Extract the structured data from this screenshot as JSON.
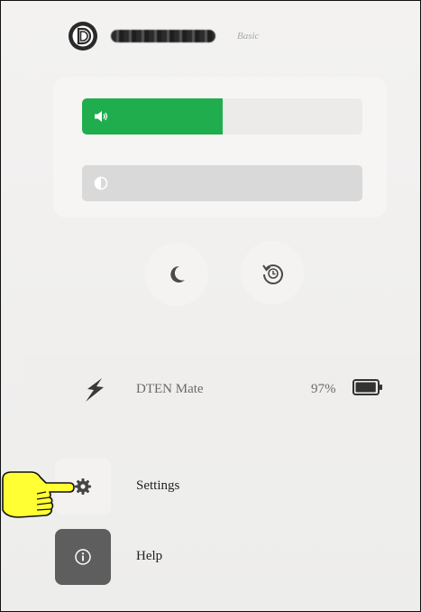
{
  "account": {
    "plan_badge": "Basic",
    "logo_icon": "dten-logo-icon",
    "username_icon": "redacted-username"
  },
  "controls": {
    "volume": {
      "icon": "speaker-icon",
      "level": 0.5,
      "color": "#1fad4e"
    },
    "brightness": {
      "icon": "contrast-icon",
      "level": 0.0
    },
    "night_mode_icon": "moon-icon",
    "restore_icon": "restore-icon"
  },
  "device": {
    "icon": "lightning-icon",
    "name": "DTEN Mate",
    "battery_text": "97%",
    "battery_level": 0.97,
    "battery_icon": "battery-icon"
  },
  "menu": [
    {
      "label": "Settings",
      "icon": "gear-icon"
    },
    {
      "label": "Help",
      "icon": "info-icon"
    }
  ],
  "annotation": {
    "icon": "pointing-hand-icon",
    "color": "#ffff33"
  }
}
